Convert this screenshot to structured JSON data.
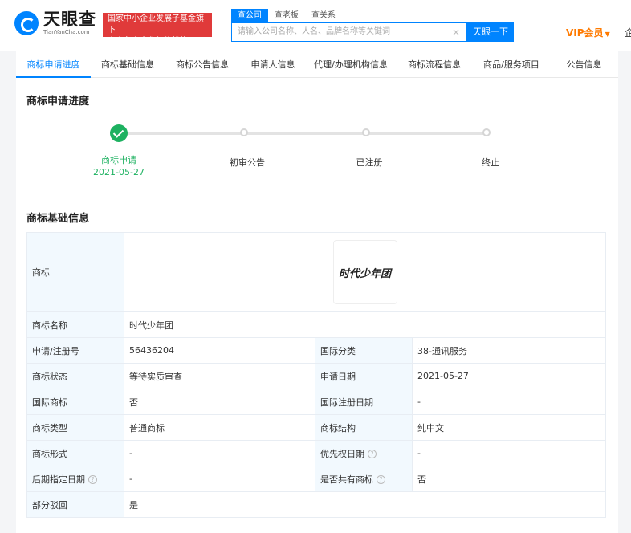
{
  "header": {
    "logo_cn": "天眼查",
    "logo_en": "TianYanCha.com",
    "badge_line1": "国家中小企业发展子基金旗下",
    "badge_line2": "官方备案企业征信机构",
    "search_tabs": [
      "查公司",
      "查老板",
      "查关系"
    ],
    "search_placeholder": "请输入公司名称、人名、品牌名称等关键词",
    "search_clear": "×",
    "search_button": "天眼一下",
    "vip_label": "VIP会员",
    "vip_caret": "▼",
    "right_cut": "企"
  },
  "nav": {
    "items": [
      "商标申请进度",
      "商标基础信息",
      "商标公告信息",
      "申请人信息",
      "代理/办理机构信息",
      "商标流程信息",
      "商品/服务项目",
      "公告信息"
    ]
  },
  "progress": {
    "title": "商标申请进度",
    "steps": [
      {
        "label": "商标申请",
        "date": "2021-05-27",
        "done": true
      },
      {
        "label": "初审公告",
        "date": "",
        "done": false
      },
      {
        "label": "已注册",
        "date": "",
        "done": false
      },
      {
        "label": "终止",
        "date": "",
        "done": false
      }
    ]
  },
  "basic": {
    "title": "商标基础信息",
    "trademark_label": "商标",
    "trademark_image_text": "时代少年团",
    "name_label": "商标名称",
    "name_value": "时代少年团",
    "rows": [
      {
        "k1": "申请/注册号",
        "v1": "56436204",
        "k2": "国际分类",
        "v2": "38-通讯服务"
      },
      {
        "k1": "商标状态",
        "v1": "等待实质审查",
        "k2": "申请日期",
        "v2": "2021-05-27"
      },
      {
        "k1": "国际商标",
        "v1": "否",
        "k2": "国际注册日期",
        "v2": "-"
      },
      {
        "k1": "商标类型",
        "v1": "普通商标",
        "k2": "商标结构",
        "v2": "纯中文"
      },
      {
        "k1": "商标形式",
        "v1": "-",
        "k2": "优先权日期",
        "v2": "-"
      },
      {
        "k1": "后期指定日期",
        "v1": "-",
        "k2": "是否共有商标",
        "v2": "否"
      }
    ],
    "partial_label": "部分驳回",
    "partial_value": "是",
    "help_glyph": "?"
  },
  "colors": {
    "brand_blue": "#0084ff",
    "success_green": "#1db160",
    "badge_red": "#e03a3a",
    "vip_orange": "#ff7a00",
    "key_cell_bg": "#f2f9fe"
  }
}
